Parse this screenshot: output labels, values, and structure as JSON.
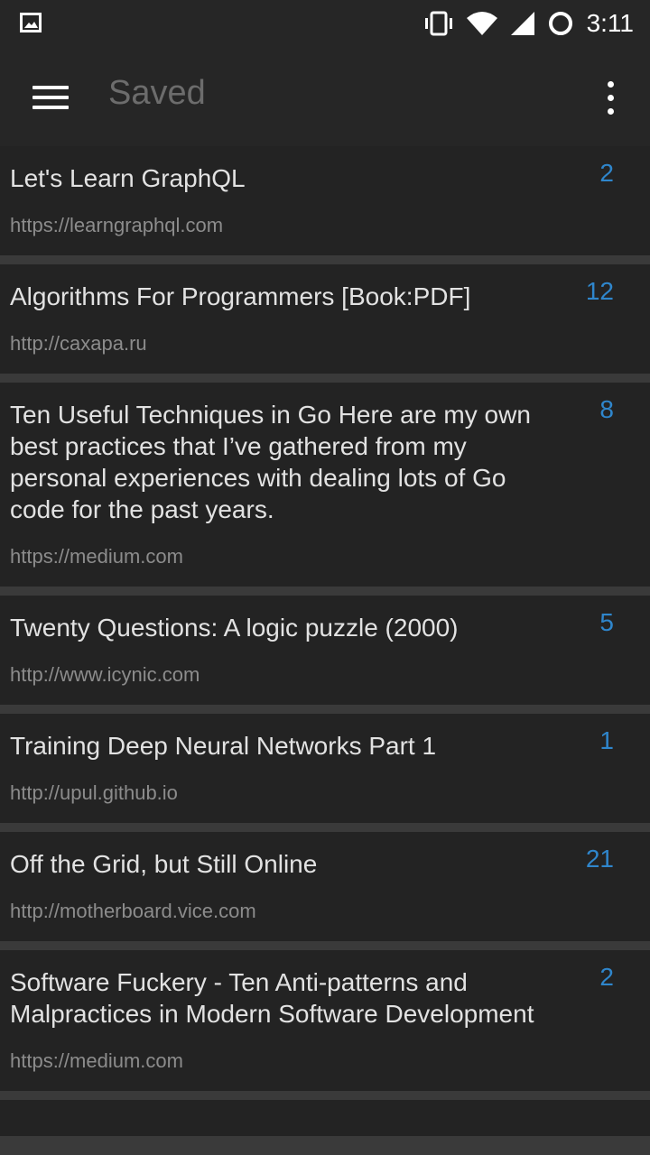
{
  "status_bar": {
    "time": "3:11",
    "icons": [
      "image-notification-icon",
      "vibrate-icon",
      "wifi-icon",
      "cell-signal-icon",
      "battery-icon"
    ]
  },
  "app_bar": {
    "title": "Saved",
    "menu_icon": "hamburger-menu-icon",
    "overflow_icon": "more-vert-icon"
  },
  "colors": {
    "background": "#232323",
    "divider": "#3a3a3a",
    "accent": "#2f86cc",
    "title_text": "#e2e2e2",
    "url_text": "#8c8c8c"
  },
  "items": [
    {
      "title": "Let's Learn GraphQL",
      "url": "https://learngraphql.com",
      "count": "2"
    },
    {
      "title": "Algorithms For Programmers [Book:PDF]",
      "url": "http://caxapa.ru",
      "count": "12"
    },
    {
      "title": "Ten Useful Techniques in Go Here are my own best practices that I’ve gathered from my personal experiences with dealing lots of Go code for the past years.",
      "url": "https://medium.com",
      "count": "8"
    },
    {
      "title": "Twenty Questions: A logic puzzle (2000)",
      "url": "http://www.icynic.com",
      "count": "5"
    },
    {
      "title": "Training Deep Neural Networks Part 1",
      "url": "http://upul.github.io",
      "count": "1"
    },
    {
      "title": "Off the Grid, but Still Online",
      "url": "http://motherboard.vice.com",
      "count": "21"
    },
    {
      "title": "Software Fuckery - Ten Anti-patterns and Malpractices in Modern Software Development",
      "url": "https://medium.com",
      "count": "2"
    }
  ]
}
